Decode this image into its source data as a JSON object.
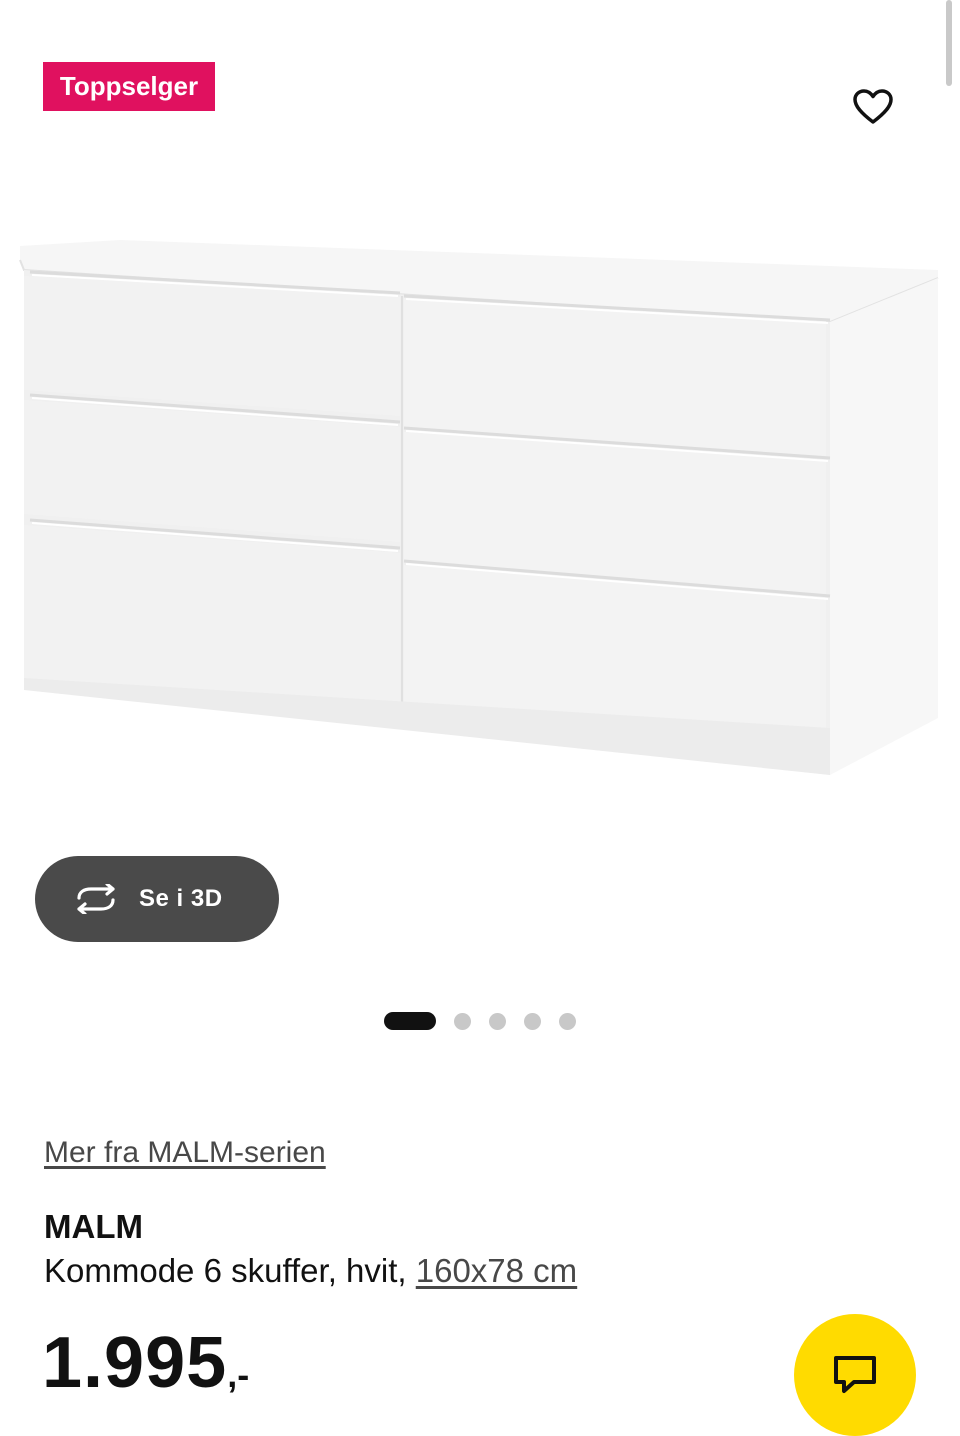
{
  "badge": {
    "label": "Toppselger",
    "color": "#e0115f"
  },
  "favorite": {
    "icon": "heart-outline-icon"
  },
  "product_image": {
    "alt": "MALM kommode 6 skuffer, hvit"
  },
  "view_3d": {
    "label": "Se i 3D",
    "icon": "rotate-3d-icon"
  },
  "carousel": {
    "total": 5,
    "active_index": 0
  },
  "series_link": {
    "label": "Mer fra MALM-serien"
  },
  "product": {
    "brand": "MALM",
    "description": "Kommode 6 skuffer, hvit,",
    "size": "160x78 cm",
    "price": "1.995",
    "price_suffix": ",-"
  },
  "chat_button": {
    "icon": "chat-icon",
    "color": "#ffdb00"
  }
}
